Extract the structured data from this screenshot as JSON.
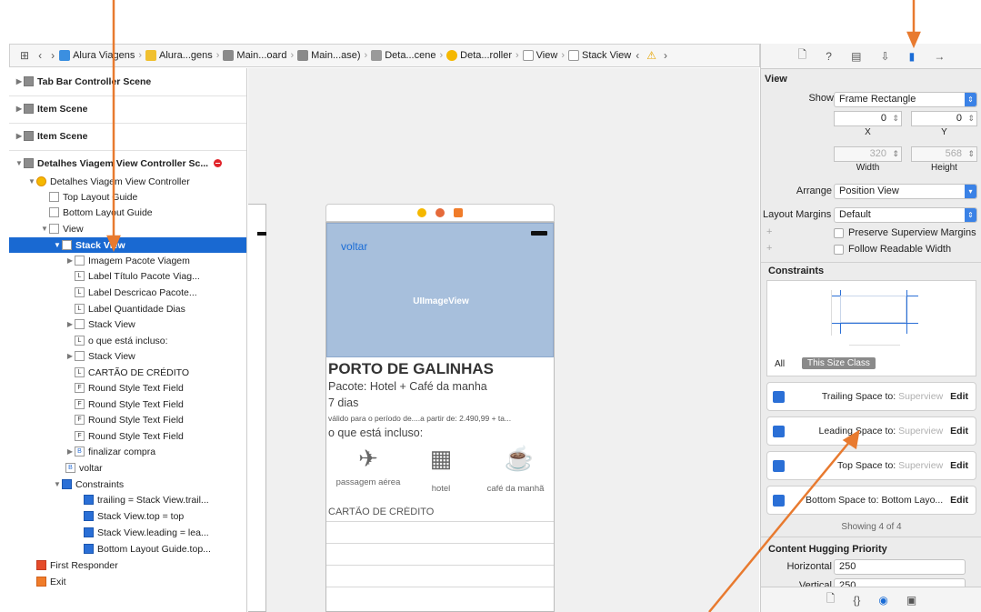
{
  "colors": {
    "accent": "#1969d2",
    "arrow": "#e87a2f",
    "image_view": "#a7bfdc",
    "warning": "#e6a400",
    "error": "#e0242a"
  },
  "toolbar": {
    "icons": [
      "grid-icon",
      "back-icon",
      "forward-icon"
    ],
    "crumbs": [
      "Alura Viagens",
      "Alura...gens",
      "Main...oard",
      "Main...ase)",
      "Deta...cene",
      "Deta...roller",
      "View",
      "Stack View"
    ]
  },
  "navigator": {
    "scenes": [
      "Tab Bar Controller Scene",
      "Item Scene",
      "Item Scene",
      "Detalhes Viagem View Controller Sc..."
    ],
    "items": [
      "Detalhes Viagem View Controller",
      "Top Layout Guide",
      "Bottom Layout Guide",
      "View",
      "Stack View",
      "Imagem Pacote Viagem",
      "Label Título Pacote Viag...",
      "Label Descricao Pacote...",
      "Label Quantidade Dias",
      "Stack View",
      "o que está incluso:",
      "Stack View",
      "CARTÃO DE CRÉDITO",
      "Round Style Text Field",
      "Round Style Text Field",
      "Round Style Text Field",
      "Round Style Text Field",
      "finalizar compra",
      "voltar",
      "Constraints",
      "trailing = Stack View.trail...",
      "Stack View.top = top",
      "Stack View.leading = lea...",
      "Bottom Layout Guide.top...",
      "First Responder",
      "Exit"
    ],
    "badges": [
      "L",
      "F",
      "B"
    ]
  },
  "canvas": {
    "voltar": "voltar",
    "image_view": "UIImageView",
    "title": "PORTO DE GALINHAS",
    "pacote": "Pacote: Hotel + Café da manha",
    "dias": "7 dias",
    "validade": "válido para o período de....a partir de: 2.490,99 + ta...",
    "incluso": "o que está incluso:",
    "feature1": "passagem aérea",
    "feature2": "hotel",
    "feature3": "café da manhã",
    "cartao": "CARTÃO DE CRÉDITO"
  },
  "inspector": {
    "section": "View",
    "show_label": "Show",
    "show_value": "Frame Rectangle",
    "x": "0",
    "y": "0",
    "width": "320",
    "height": "568",
    "x_label": "X",
    "y_label": "Y",
    "w_label": "Width",
    "h_label": "Height",
    "arrange_label": "Arrange",
    "arrange_value": "Position View",
    "margins_label": "Layout Margins",
    "margins_value": "Default",
    "preserve": "Preserve Superview Margins",
    "readable": "Follow Readable Width",
    "constraints_title": "Constraints",
    "all": "All",
    "size_class": "This Size Class",
    "c1": "Trailing Space to:",
    "c1v": "Superview",
    "c2": "Leading Space to:",
    "c2v": "Superview",
    "c3": "Top Space to:",
    "c3v": "Superview",
    "c4": "Bottom Space to:",
    "c4v": "Bottom Layo...",
    "edit": "Edit",
    "showing": "Showing 4 of 4",
    "hugging_title": "Content Hugging Priority",
    "horizontal_label": "Horizontal",
    "horizontal_value": "250",
    "vertical_label": "Vertical",
    "vertical_value": "250",
    "plus": "+"
  }
}
